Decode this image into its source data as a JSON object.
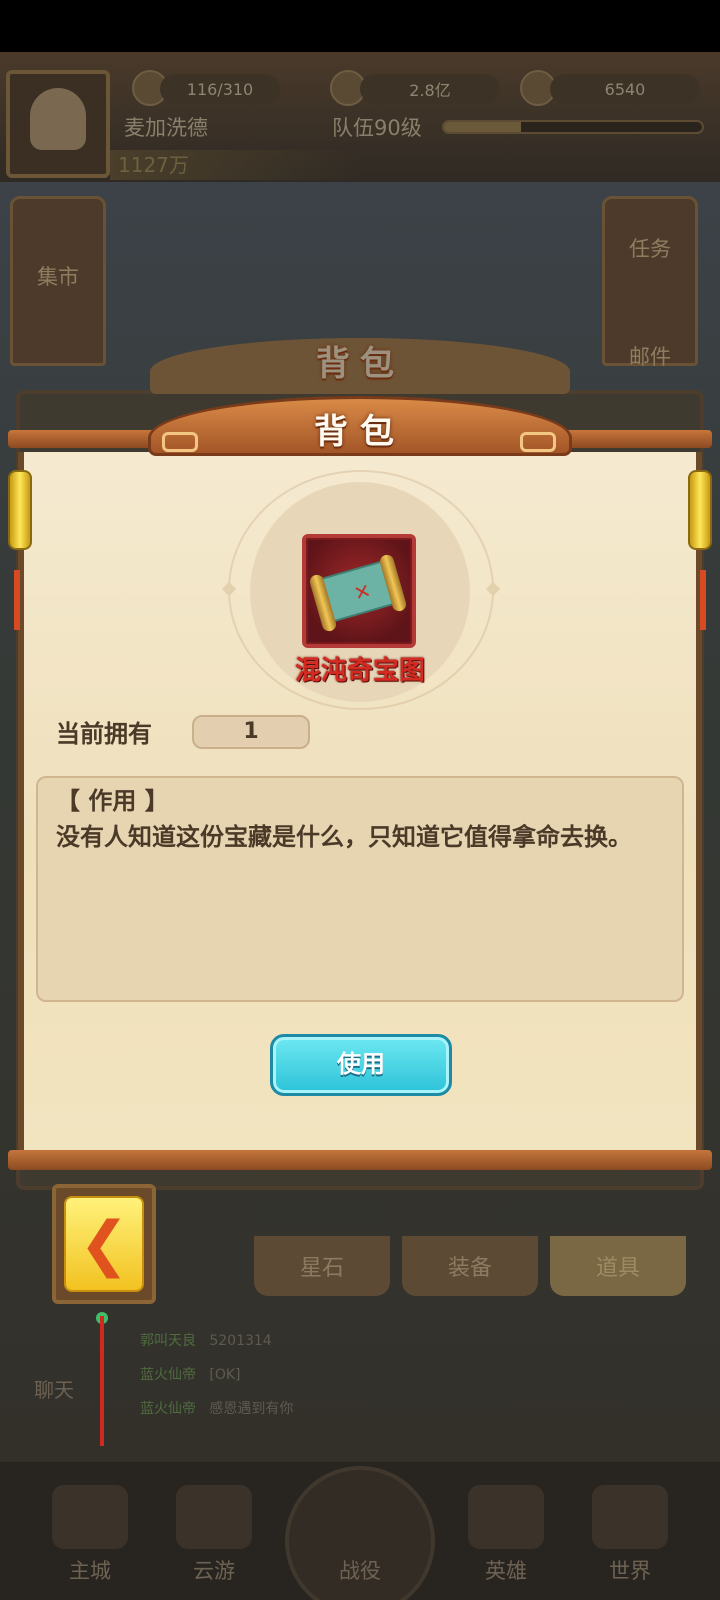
{
  "background": {
    "stamina": "116/310",
    "gold": "2.8亿",
    "gems": "6540",
    "player_name": "麦加洗德",
    "team_level": "队伍90级",
    "team_exp_fraction": 0.3,
    "power": "1127万",
    "left_banner": "集市",
    "right_banners": [
      "任务",
      "邮件"
    ],
    "tabs": [
      "星石",
      "装备",
      "道具"
    ],
    "active_tab": "道具",
    "chat": [
      {
        "channel": "郭叫天良",
        "text": "5201314"
      },
      {
        "channel": "蓝火仙帝",
        "text": "[OK]"
      },
      {
        "channel": "蓝火仙帝",
        "text": "感恩遇到有你"
      }
    ],
    "chat_label": "聊天",
    "bottom_nav": [
      "主城",
      "云游",
      "战役",
      "英雄",
      "世界"
    ]
  },
  "dialog": {
    "back_title": "背包",
    "title": "背包",
    "item_name": "混沌奇宝图",
    "owned_label": "当前拥有",
    "owned_count": "1",
    "effect_header": "【 作用 】",
    "effect_text": "没有人知道这份宝藏是什么，只知道它值得拿命去换。",
    "use_button": "使用",
    "back_button_icon": "back-arrow-icon"
  },
  "colors": {
    "panel_bg": "#f5ead0",
    "title_roof": "#d98a47",
    "item_name": "#d42a22",
    "use_button": "#2cc2d8",
    "text_brown": "#4b3a28"
  }
}
